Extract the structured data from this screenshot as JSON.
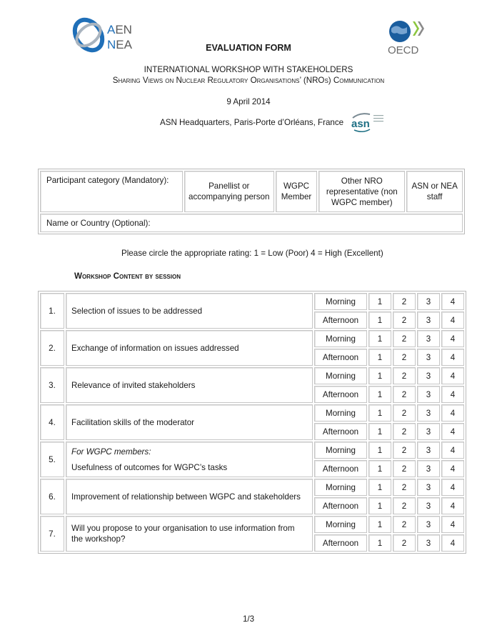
{
  "header": {
    "logos": {
      "left": "aen-nea-logo",
      "left_text": [
        "AEN",
        "NEA"
      ],
      "right": "oecd-logo",
      "right_text": "OECD",
      "venue": "asn-logo",
      "venue_text": "asn"
    },
    "form_title": "EVALUATION FORM",
    "workshop_title": "INTERNATIONAL WORKSHOP WITH STAKEHOLDERS",
    "workshop_subtitle": "Sharing Views on Nuclear Regulatory Organisations’ (NROs) Communication",
    "date": "9 April 2014",
    "location": "ASN Headquarters, Paris-Porte d’Orléans, France"
  },
  "participant": {
    "category_label": "Participant category (Mandatory):",
    "options": [
      "Panellist or accompanying person",
      "WGPC Member",
      "Other NRO representative (non WGPC member)",
      "ASN or NEA staff"
    ],
    "name_label": "Name or Country (Optional):"
  },
  "instructions": "Please circle the appropriate rating: 1 = Low (Poor) 4 = High (Excellent)",
  "section_title": "Workshop Content by session",
  "sessions": [
    "Morning",
    "Afternoon"
  ],
  "ratings": [
    "1",
    "2",
    "3",
    "4"
  ],
  "items": [
    {
      "num": "1.",
      "prefix": "",
      "text": "Selection of issues to be addressed"
    },
    {
      "num": "2.",
      "prefix": "",
      "text": "Exchange of information on issues addressed"
    },
    {
      "num": "3.",
      "prefix": "",
      "text": "Relevance of invited stakeholders"
    },
    {
      "num": "4.",
      "prefix": "",
      "text": "Facilitation skills of the moderator"
    },
    {
      "num": "5.",
      "prefix": "For WGPC members:",
      "text": "Usefulness of outcomes for WGPC’s tasks"
    },
    {
      "num": "6.",
      "prefix": "",
      "text": "Improvement of relationship between WGPC and stakeholders"
    },
    {
      "num": "7.",
      "prefix": "",
      "text": "Will you propose to your organisation to use information from the workshop?"
    }
  ],
  "footer": {
    "page_number": "1/3"
  },
  "colors": {
    "nea_blue": "#1f6fb8",
    "oecd_globe": "#1a5d9e",
    "oecd_chevron": "#8cc63f",
    "oecd_text": "#6b6b6b",
    "asn_teal": "#1d6f84",
    "border": "#c6c6c6"
  }
}
